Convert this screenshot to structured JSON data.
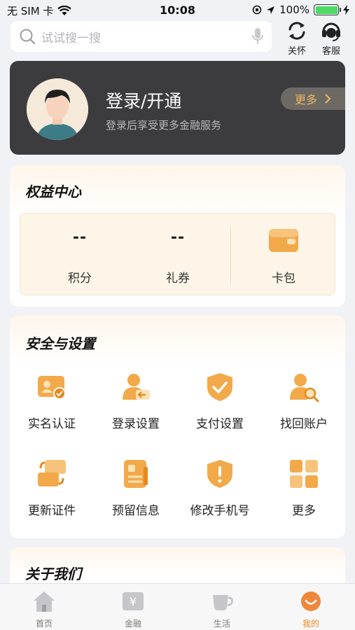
{
  "status_bar": {
    "carrier": "无 SIM 卡",
    "time": "10:08",
    "battery": "100%",
    "battery_level": 1.0
  },
  "header": {
    "search_placeholder": "试试搜一搜",
    "care_label": "关怀",
    "service_label": "客服"
  },
  "login": {
    "title": "登录/开通",
    "subtitle": "登录后享受更多金融服务",
    "more_label": "更多"
  },
  "rights": {
    "title": "权益中心",
    "items": [
      {
        "value": "--",
        "label": "积分"
      },
      {
        "value": "--",
        "label": "礼券"
      },
      {
        "label": "卡包",
        "icon": "wallet-icon"
      }
    ]
  },
  "security": {
    "title": "安全与设置",
    "items": [
      {
        "label": "实名认证",
        "icon": "id-card-check-icon"
      },
      {
        "label": "登录设置",
        "icon": "user-login-icon"
      },
      {
        "label": "支付设置",
        "icon": "shield-check-icon"
      },
      {
        "label": "找回账户",
        "icon": "user-search-icon"
      },
      {
        "label": "更新证件",
        "icon": "card-swap-icon"
      },
      {
        "label": "预留信息",
        "icon": "document-icon"
      },
      {
        "label": "修改手机号",
        "icon": "shield-alert-icon"
      },
      {
        "label": "更多",
        "icon": "grid-icon"
      }
    ]
  },
  "about": {
    "title": "关于我们"
  },
  "tabbar": {
    "items": [
      {
        "label": "首页",
        "icon": "home-icon",
        "active": false
      },
      {
        "label": "金融",
        "icon": "finance-icon",
        "active": false
      },
      {
        "label": "生活",
        "icon": "cup-icon",
        "active": false
      },
      {
        "label": "我的",
        "icon": "smile-icon",
        "active": true
      }
    ]
  },
  "colors": {
    "accent": "#f0a23a",
    "accent_dark": "#e8891c",
    "login_bg": "#3c3c3f"
  }
}
